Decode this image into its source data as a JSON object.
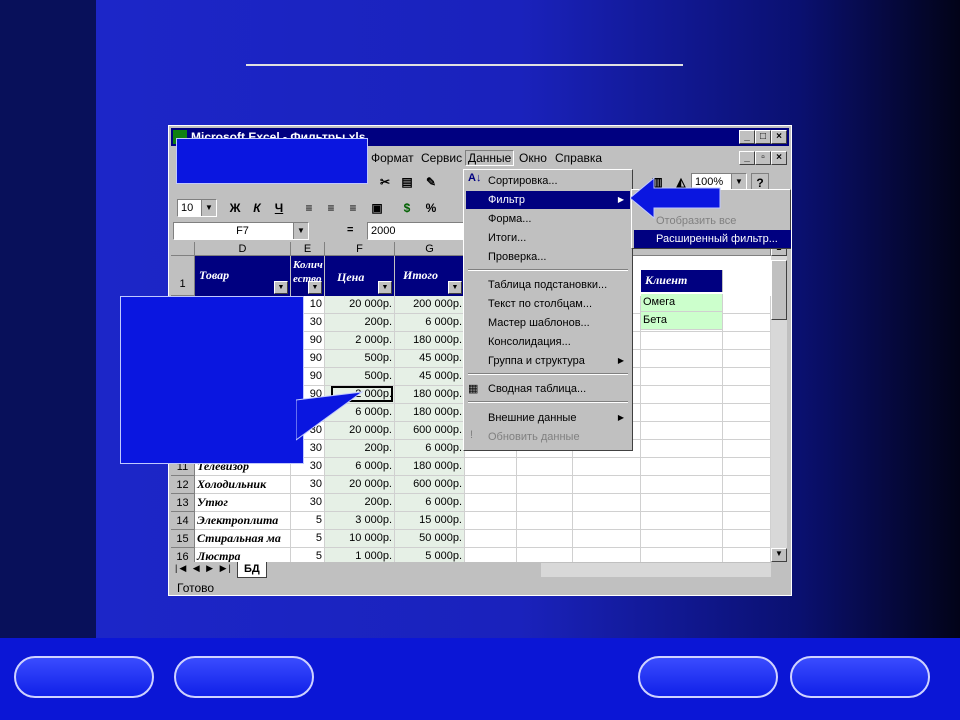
{
  "excel": {
    "title": "Microsoft Excel - Фильтры.xls",
    "menu": [
      "Формат",
      "Сервис",
      "Данные",
      "Окно",
      "Справка"
    ],
    "zoom": "100%",
    "font_size": "10",
    "format_buttons": [
      "Ж",
      "К",
      "Ч",
      "%"
    ],
    "name_box": "F7",
    "formula_eq": "=",
    "formula_value": "2000",
    "columns": [
      "D",
      "E",
      "F",
      "G"
    ],
    "header_row": "1",
    "headers": {
      "product": "Товар",
      "qty": "Колич ество",
      "price": "Цена",
      "total": "Итого",
      "client": "Клиент"
    },
    "criteria": [
      "Омега",
      "Бета"
    ],
    "rows": [
      {
        "num": "",
        "name": "",
        "qty": "10",
        "price": "20 000р.",
        "total": "200 000р."
      },
      {
        "num": "",
        "name": "",
        "qty": "30",
        "price": "200р.",
        "total": "6 000р."
      },
      {
        "num": "",
        "name": "",
        "qty": "90",
        "price": "2 000р.",
        "total": "180 000р."
      },
      {
        "num": "",
        "name": "",
        "qty": "90",
        "price": "500р.",
        "total": "45 000р."
      },
      {
        "num": "",
        "name": "",
        "qty": "90",
        "price": "500р.",
        "total": "45 000р."
      },
      {
        "num": "",
        "name": "",
        "qty": "90",
        "price": "2 000р.",
        "total": "180 000р."
      },
      {
        "num": "",
        "name": "",
        "qty": "",
        "price": "6 000р.",
        "total": "180 000р."
      },
      {
        "num": "",
        "name": "",
        "qty": "30",
        "price": "20 000р.",
        "total": "600 000р."
      },
      {
        "num": "",
        "name": "",
        "qty": "30",
        "price": "200р.",
        "total": "6 000р."
      },
      {
        "num": "11",
        "name": "Телевизор",
        "qty": "30",
        "price": "6 000р.",
        "total": "180 000р."
      },
      {
        "num": "12",
        "name": "Холодильник",
        "qty": "30",
        "price": "20 000р.",
        "total": "600 000р."
      },
      {
        "num": "13",
        "name": "Утюг",
        "qty": "30",
        "price": "200р.",
        "total": "6 000р."
      },
      {
        "num": "14",
        "name": "Электроплита",
        "qty": "5",
        "price": "3 000р.",
        "total": "15 000р."
      },
      {
        "num": "15",
        "name": "Стиральная ма",
        "qty": "5",
        "price": "10 000р.",
        "total": "50 000р."
      },
      {
        "num": "16",
        "name": "Люстра",
        "qty": "5",
        "price": "1 000р.",
        "total": "5 000р."
      }
    ],
    "data_menu": [
      "Сортировка...",
      "Фильтр",
      "Форма...",
      "Итоги...",
      "Проверка...",
      "Таблица подстановки...",
      "Текст по столбцам...",
      "Мастер шаблонов...",
      "Консолидация...",
      "Группа и структура",
      "Сводная таблица...",
      "Внешние данные",
      "Обновить данные"
    ],
    "filter_submenu": [
      "Отобразить все",
      "Расширенный фильтр..."
    ],
    "sheet_tab": "БД",
    "status": "Готово"
  }
}
